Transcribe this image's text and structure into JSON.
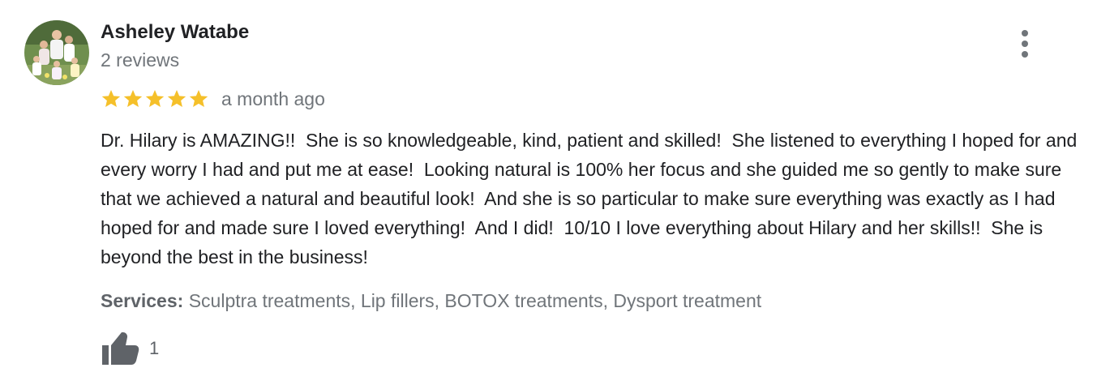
{
  "review": {
    "author": {
      "name": "Asheley Watabe",
      "reviews_count": "2 reviews",
      "avatar_icon": "family-photo-avatar"
    },
    "rating": 5,
    "max_rating": 5,
    "date": "a month ago",
    "text": "Dr. Hilary is AMAZING!!  She is so knowledgeable, kind, patient and skilled!  She listened to everything I hoped for and every worry I had and put me at ease!  Looking natural is 100% her focus and she guided me so gently to make sure that we achieved a natural and beautiful look!  And she is so particular to make sure everything was exactly as I had hoped for and made sure I loved everything!  And I did!  10/10 I love everything about Hilary and her skills!!  She is beyond the best in the business!",
    "services": {
      "label": "Services:",
      "value": "Sculptra treatments, Lip fillers, BOTOX treatments, Dysport treatment"
    },
    "likes": {
      "icon": "thumbs-up-icon",
      "count": "1"
    },
    "menu_icon": "more-vert-icon"
  },
  "colors": {
    "star": "#f5c02a",
    "primary_text": "#202124",
    "secondary_text": "#70757a",
    "icon": "#5f6368"
  }
}
